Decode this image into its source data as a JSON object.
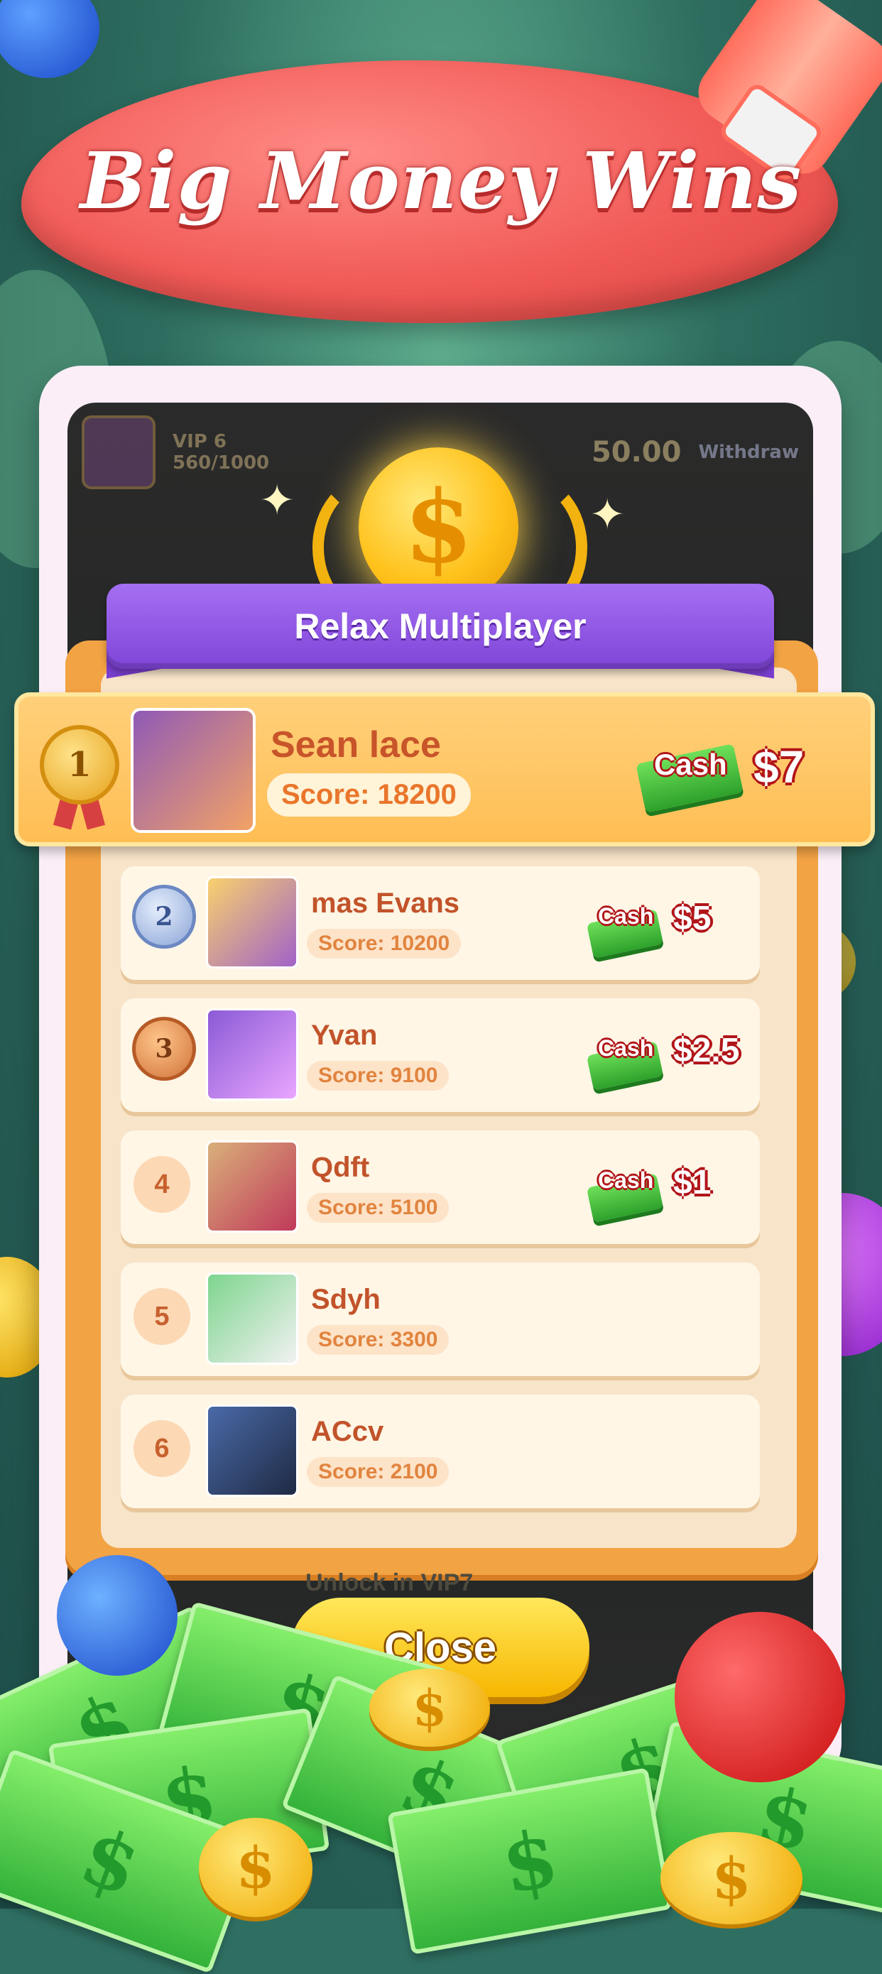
{
  "headline": "Big Money Wins",
  "game_topbar": {
    "vip_level": "VIP 6",
    "vip_progress": "560/1000",
    "balance": "50.00",
    "withdraw_label": "Withdraw"
  },
  "mode_title": "Relax Multiplayer",
  "leaderboard": {
    "first": {
      "rank": "1",
      "name": "Sean lace",
      "score": "Score: 18200",
      "cash_label": "Cash",
      "prize": "$7"
    },
    "rows": [
      {
        "rank": "2",
        "name": "mas Evans",
        "score": "Score: 10200",
        "cash_label": "Cash",
        "prize": "$5"
      },
      {
        "rank": "3",
        "name": "Yvan",
        "score": "Score: 9100",
        "cash_label": "Cash",
        "prize": "$2.5"
      },
      {
        "rank": "4",
        "name": "Qdft",
        "score": "Score: 5100",
        "cash_label": "Cash",
        "prize": "$1"
      },
      {
        "rank": "5",
        "name": "Sdyh",
        "score": "Score: 3300"
      },
      {
        "rank": "6",
        "name": "ACcv",
        "score": "Score: 2100"
      }
    ]
  },
  "unlock_text": "Unlock in VIP7",
  "close_button": "Close",
  "icons": {
    "coin": "dollar-coin-icon",
    "medal_gold": "gold-medal-icon",
    "medal_silver": "silver-medal-icon",
    "medal_bronze": "bronze-medal-icon",
    "cash": "cash-stack-icon"
  },
  "colors": {
    "headline_blob": "#f15a57",
    "ribbon": "#8a4fe0",
    "board": "#f2a344",
    "close_button": "#f7c400",
    "prize_outline": "#b1151a"
  }
}
